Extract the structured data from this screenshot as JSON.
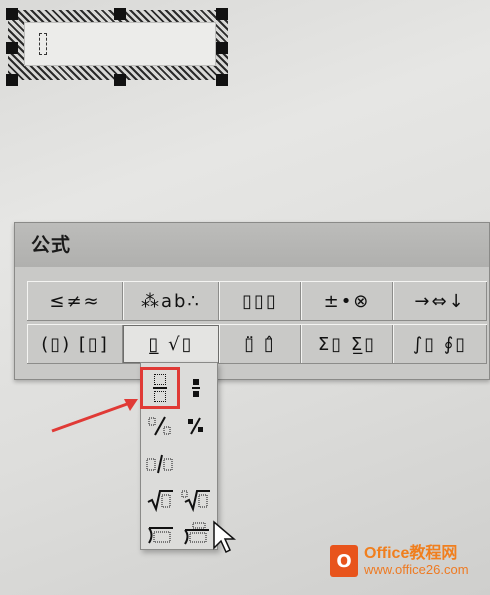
{
  "toolbar": {
    "title": "公式",
    "row1": [
      {
        "label": "≤≠≈"
      },
      {
        "label": "⁂ab∴"
      },
      {
        "label": "▯▯▯"
      },
      {
        "label": "±•⊗"
      },
      {
        "label": "→⇔↓"
      }
    ],
    "row2": [
      {
        "label": "(▯) [▯]"
      },
      {
        "label": "▯̲ √▯",
        "active": true
      },
      {
        "label": "▯̈ ▯̂"
      },
      {
        "label": "Σ▯ Σ̲▯"
      },
      {
        "label": "∫▯ ∮▯"
      }
    ]
  },
  "dropdown": {
    "items": [
      "fraction-full",
      "fraction-small",
      "slash-fraction",
      "slash-fraction-small",
      "fraction-inline",
      "square-root",
      "nth-root",
      "long-division",
      "long-division-alt"
    ]
  },
  "colors": {
    "highlight": "#e03a36",
    "watermark": "#e8541c"
  },
  "watermark": {
    "brand": "Office教程网",
    "url": "www.office26.com"
  }
}
